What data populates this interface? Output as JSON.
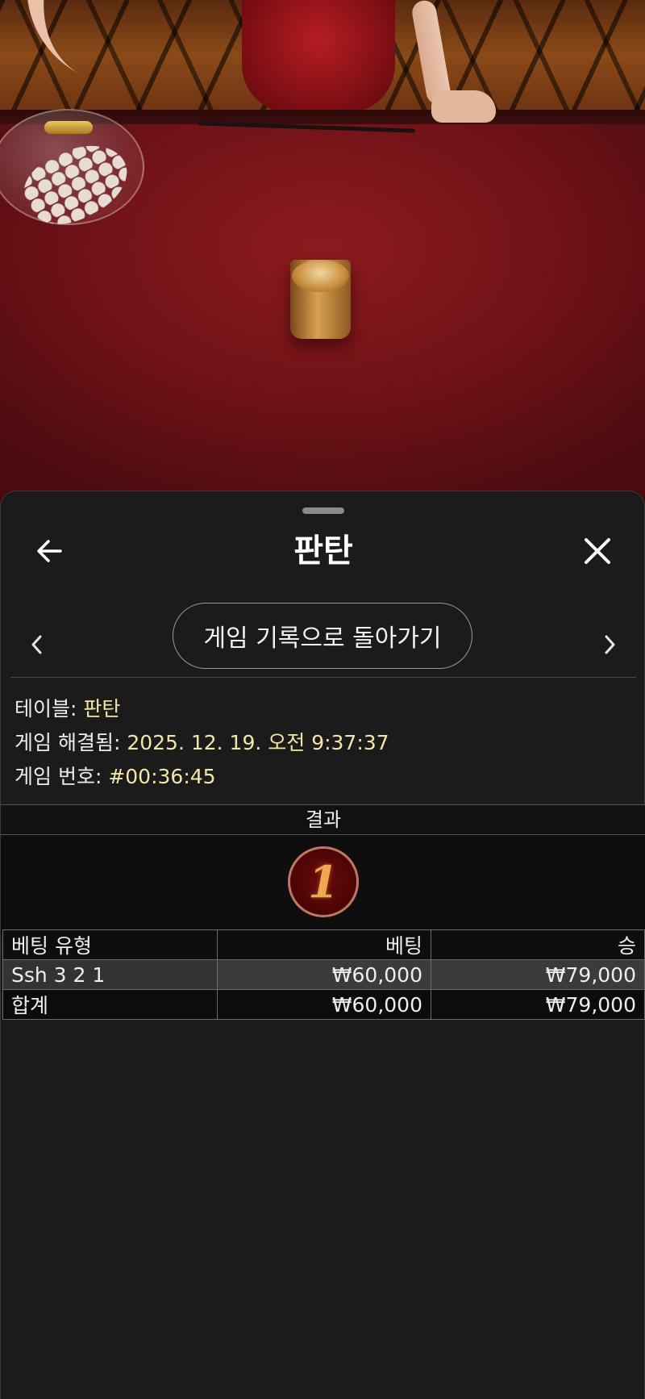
{
  "game_title": "판탄",
  "nav": {
    "return_label": "게임 기록으로 돌아가기"
  },
  "info": {
    "table_label": "테이블:",
    "table_value": "판탄",
    "resolved_label": "게임 해결됨:",
    "resolved_value": "2025. 12. 19. 오전 9:37:37",
    "game_no_label": "게임 번호:",
    "game_no_value": "#00:36:45"
  },
  "result": {
    "label": "결과",
    "number": "1"
  },
  "bets": {
    "headers": [
      "베팅 유형",
      "베팅",
      "승"
    ],
    "rows": [
      {
        "type": "Ssh 3 2 1",
        "bet": "₩60,000",
        "win": "₩79,000"
      }
    ],
    "total": {
      "type": "합계",
      "bet": "₩60,000",
      "win": "₩79,000"
    }
  },
  "icons": {
    "back": "arrow-left-icon",
    "close": "close-icon",
    "prev": "chevron-left-icon",
    "next": "chevron-right-icon"
  },
  "colors": {
    "value_text": "#f4e6a6",
    "sheet_bg": "#1b1b1b",
    "result_ball": "#4a0404"
  }
}
